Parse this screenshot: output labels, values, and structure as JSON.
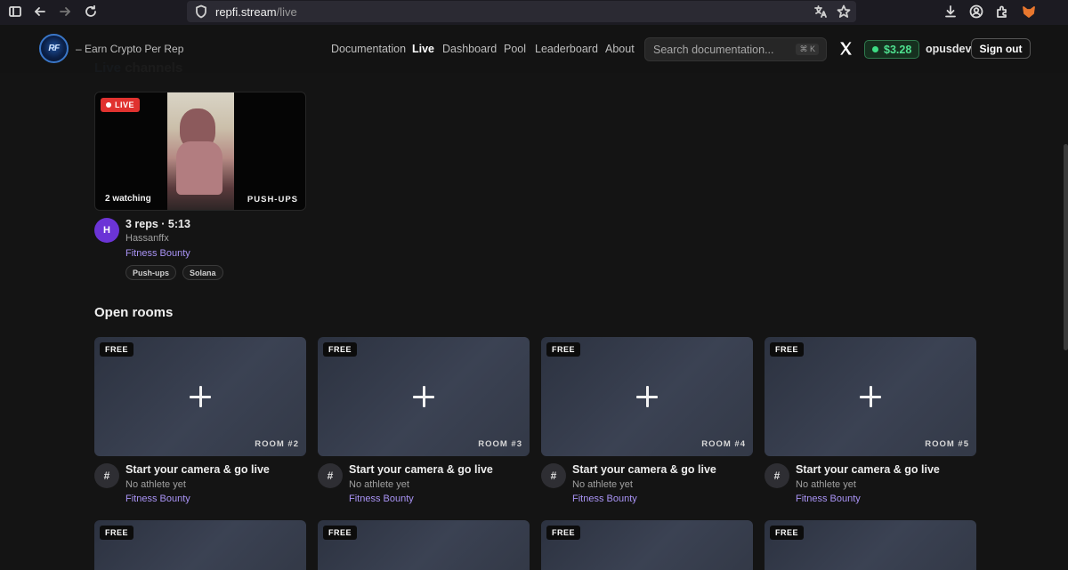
{
  "browser": {
    "url_host": "repfi.stream",
    "url_path": "/live"
  },
  "header": {
    "logo_text": "RF",
    "tagline": "– Earn Crypto Per Rep",
    "nav": [
      "Documentation",
      "Live",
      "Dashboard",
      "Pool",
      "Leaderboard",
      "About"
    ],
    "active_nav": "Live",
    "search_placeholder": "Search documentation...",
    "search_shortcut": "⌘ K",
    "balance": "$3.28",
    "username": "opusdev",
    "signout_label": "Sign out"
  },
  "colors": {
    "live_red": "#e0322f",
    "balance_green": "#4ee08f",
    "link_purple": "#a993f5",
    "avatar_purple": "#6b34d6"
  },
  "live_section": {
    "title_accent": "Live",
    "title_rest": "channels",
    "channel": {
      "badge": "LIVE",
      "watching": "2 watching",
      "exercise": "PUSH-UPS",
      "avatar_initial": "H",
      "stats": "3 reps · 5:13",
      "athlete": "Hassanffx",
      "bounty": "Fitness Bounty",
      "tags": [
        "Push-ups",
        "Solana"
      ]
    }
  },
  "open_rooms": {
    "title": "Open rooms",
    "rooms": [
      {
        "badge": "FREE",
        "label": "ROOM #2",
        "avatar": "#",
        "title": "Start your camera & go live",
        "subtitle": "No athlete yet",
        "bounty": "Fitness Bounty"
      },
      {
        "badge": "FREE",
        "label": "ROOM #3",
        "avatar": "#",
        "title": "Start your camera & go live",
        "subtitle": "No athlete yet",
        "bounty": "Fitness Bounty"
      },
      {
        "badge": "FREE",
        "label": "ROOM #4",
        "avatar": "#",
        "title": "Start your camera & go live",
        "subtitle": "No athlete yet",
        "bounty": "Fitness Bounty"
      },
      {
        "badge": "FREE",
        "label": "ROOM #5",
        "avatar": "#",
        "title": "Start your camera & go live",
        "subtitle": "No athlete yet",
        "bounty": "Fitness Bounty"
      }
    ],
    "next_row_badges": [
      "FREE",
      "FREE",
      "FREE",
      "FREE"
    ]
  }
}
